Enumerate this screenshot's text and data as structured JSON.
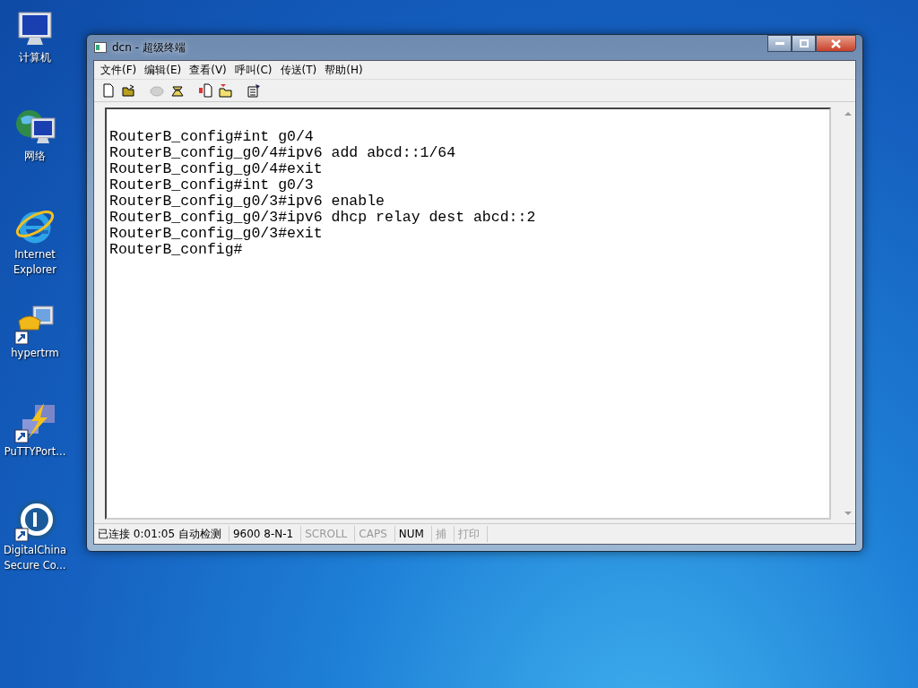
{
  "desktop_icons": [
    {
      "kind": "computer",
      "label": "计算机"
    },
    {
      "kind": "network",
      "label": "网络"
    },
    {
      "kind": "browser",
      "label": "Internet Explorer"
    },
    {
      "kind": "phone",
      "label": "hypertrm"
    },
    {
      "kind": "lightning",
      "label": "PuTTYPort..."
    },
    {
      "kind": "disc",
      "label": "DigitalChina Secure Co..."
    }
  ],
  "window": {
    "title": "dcn - 超级终端",
    "menu": [
      "文件(F)",
      "编辑(E)",
      "查看(V)",
      "呼叫(C)",
      "传送(T)",
      "帮助(H)"
    ],
    "toolbar": [
      {
        "kind": "new",
        "disabled": false
      },
      {
        "kind": "open",
        "disabled": false
      },
      {
        "kind": "call",
        "disabled": true
      },
      {
        "kind": "disconnect",
        "disabled": false
      },
      {
        "kind": "send",
        "disabled": false
      },
      {
        "kind": "receive",
        "disabled": false
      },
      {
        "kind": "properties",
        "disabled": false
      }
    ],
    "terminal_lines": [
      "RouterB_config#int g0/4",
      "RouterB_config_g0/4#ipv6 add abcd::1/64",
      "RouterB_config_g0/4#exit",
      "RouterB_config#int g0/3",
      "RouterB_config_g0/3#ipv6 enable",
      "RouterB_config_g0/3#ipv6 dhcp relay dest abcd::2",
      "RouterB_config_g0/3#exit",
      "RouterB_config#"
    ],
    "status_bar": [
      {
        "text": "已连接 0:01:05 自动检测",
        "active": true
      },
      {
        "text": "9600 8-N-1",
        "active": true
      },
      {
        "text": "SCROLL",
        "active": false
      },
      {
        "text": "CAPS",
        "active": false
      },
      {
        "text": "NUM",
        "active": true
      },
      {
        "text": "捕",
        "active": false
      },
      {
        "text": "打印",
        "active": false
      }
    ]
  }
}
